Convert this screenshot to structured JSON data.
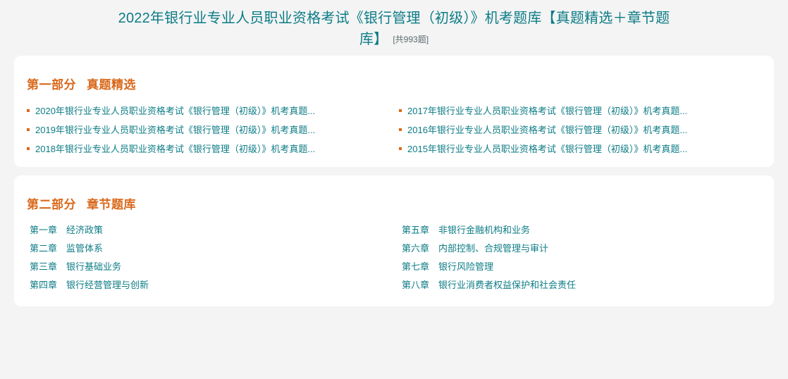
{
  "header": {
    "title": "2022年银行业专业人员职业资格考试《银行管理（初级）》机考题库【真题精选＋章节题库】",
    "question_count_label": "[共993题]"
  },
  "theme": {
    "page_background": "#f4f4f4",
    "card_background": "#ffffff",
    "accent_teal": "#0d7c86",
    "accent_orange": "#d9691c",
    "count_text": "#5c6b6d"
  },
  "part1": {
    "index_label": "第一部分",
    "title_label": "真题精选",
    "columns": [
      {
        "items": [
          {
            "label": "2020年银行业专业人员职业资格考试《银行管理（初级）》机考真题..."
          },
          {
            "label": "2019年银行业专业人员职业资格考试《银行管理（初级）》机考真题..."
          },
          {
            "label": "2018年银行业专业人员职业资格考试《银行管理（初级）》机考真题..."
          }
        ]
      },
      {
        "items": [
          {
            "label": "2017年银行业专业人员职业资格考试《银行管理（初级）》机考真题..."
          },
          {
            "label": "2016年银行业专业人员职业资格考试《银行管理（初级）》机考真题..."
          },
          {
            "label": "2015年银行业专业人员职业资格考试《银行管理（初级）》机考真题..."
          }
        ]
      }
    ]
  },
  "part2": {
    "index_label": "第二部分",
    "title_label": "章节题库",
    "columns": [
      {
        "items": [
          {
            "number": "第一章",
            "label": "经济政策"
          },
          {
            "number": "第二章",
            "label": "监管体系"
          },
          {
            "number": "第三章",
            "label": "银行基础业务"
          },
          {
            "number": "第四章",
            "label": "银行经营管理与创新"
          }
        ]
      },
      {
        "items": [
          {
            "number": "第五章",
            "label": "非银行金融机构和业务"
          },
          {
            "number": "第六章",
            "label": "内部控制、合规管理与审计"
          },
          {
            "number": "第七章",
            "label": "银行风险管理"
          },
          {
            "number": "第八章",
            "label": "银行业消费者权益保护和社会责任"
          }
        ]
      }
    ]
  }
}
